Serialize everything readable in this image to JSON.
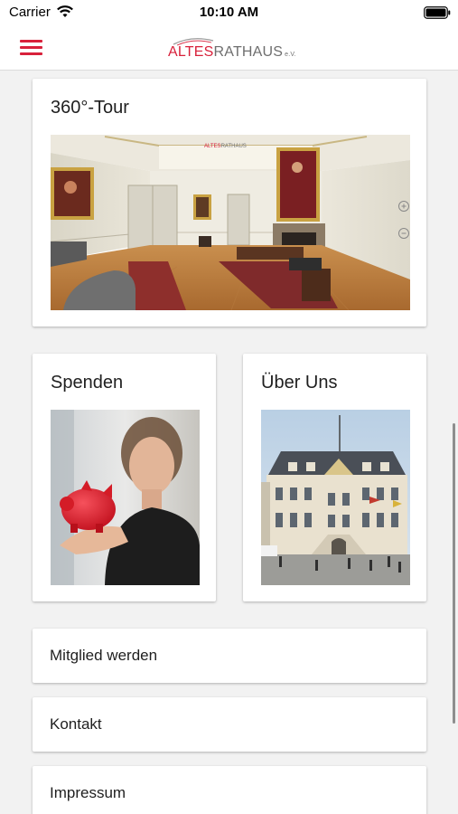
{
  "status_bar": {
    "carrier": "Carrier",
    "time": "10:10 AM"
  },
  "nav": {
    "logo": {
      "word1": "ALTES",
      "word2": "RATHAUS",
      "suffix": "e.V."
    }
  },
  "cards": {
    "tour": {
      "title": "360°-Tour"
    },
    "spenden": {
      "title": "Spenden"
    },
    "ueber_uns": {
      "title": "Über Uns"
    }
  },
  "menu": [
    {
      "label": "Mitglied werden"
    },
    {
      "label": "Kontakt"
    },
    {
      "label": "Impressum"
    }
  ],
  "colors": {
    "brand_red": "#d8213b"
  },
  "icons": [
    "hamburger-menu-icon",
    "wifi-icon",
    "battery-icon",
    "zoom-in-icon",
    "zoom-out-icon"
  ]
}
